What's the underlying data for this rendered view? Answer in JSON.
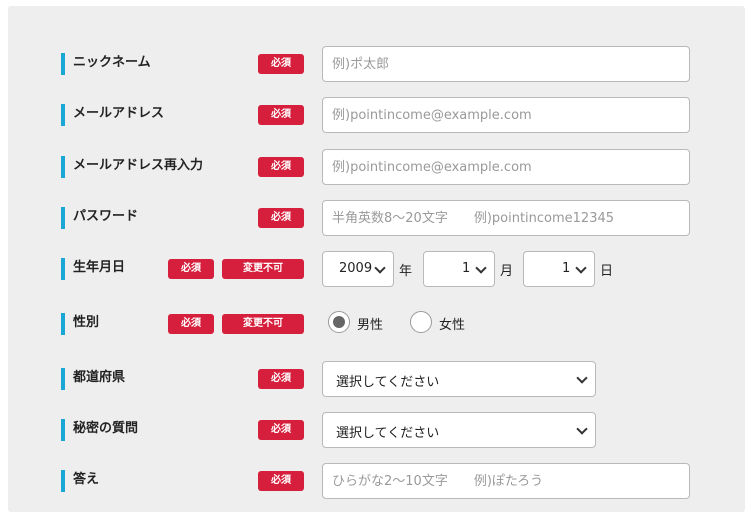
{
  "form": {
    "required_badge": "必須",
    "locked_badge": "変更不可",
    "nickname": {
      "label": "ニックネーム",
      "placeholder": "例)ポ太郎"
    },
    "email": {
      "label": "メールアドレス",
      "placeholder": "例)pointincome@example.com"
    },
    "email_confirm": {
      "label": "メールアドレス再入力",
      "placeholder": "例)pointincome@example.com"
    },
    "password": {
      "label": "パスワード",
      "placeholder": "半角英数8～20文字　　例)pointincome12345"
    },
    "birthdate": {
      "label": "生年月日",
      "year_value": "2009",
      "year_unit": "年",
      "month_value": "1",
      "month_unit": "月",
      "day_value": "1",
      "day_unit": "日"
    },
    "gender": {
      "label": "性別",
      "options": [
        {
          "label": "男性",
          "selected": true
        },
        {
          "label": "女性",
          "selected": false
        }
      ]
    },
    "prefecture": {
      "label": "都道府県",
      "value": "選択してください"
    },
    "secret_question": {
      "label": "秘密の質問",
      "value": "選択してください"
    },
    "answer": {
      "label": "答え",
      "placeholder": "ひらがな2～10文字　　例)ぽたろう"
    }
  },
  "colors": {
    "accent_bar": "#1aa7d6",
    "badge": "#d61f3c",
    "panel_bg": "#eeeeee"
  }
}
